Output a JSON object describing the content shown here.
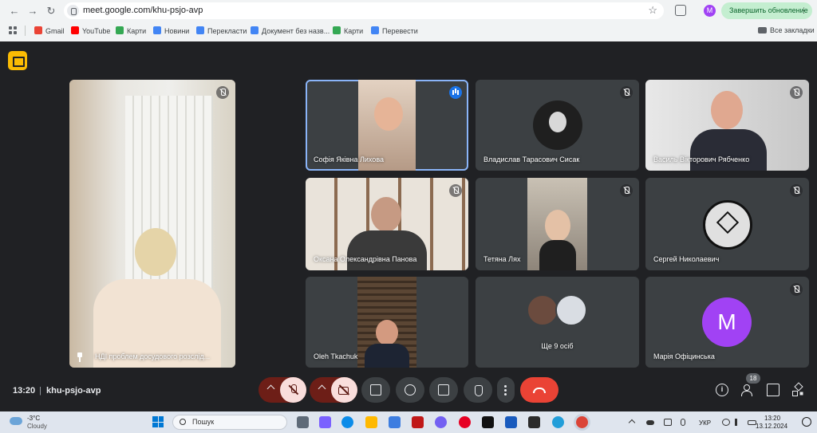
{
  "browser": {
    "url": "meet.google.com/khu-psjo-avp",
    "update_label": "Завершить обновление",
    "profile_initial": "M",
    "bookmarks": [
      {
        "label": "Gmail",
        "color": "#ea4335"
      },
      {
        "label": "YouTube",
        "color": "#ff0000"
      },
      {
        "label": "Карти",
        "color": "#34a853"
      },
      {
        "label": "Новини",
        "color": "#4285f4"
      },
      {
        "label": "Перекласти",
        "color": "#4285f4"
      },
      {
        "label": "Документ без назв...",
        "color": "#4285f4"
      },
      {
        "label": "Карти",
        "color": "#34a853"
      },
      {
        "label": "Перевести",
        "color": "#4285f4"
      }
    ],
    "all_bookmarks_label": "Все закладки"
  },
  "meet": {
    "pinned": {
      "name": "НДІ проблем досудового розслід..."
    },
    "tiles": [
      {
        "name": "Софія Яківна Лихова",
        "state": "speaking"
      },
      {
        "name": "Владислав Тарасович Сисак",
        "state": "muted"
      },
      {
        "name": "Василь Вікторович Рябченко",
        "state": "muted"
      },
      {
        "name": "Оксана Олександрівна Панова",
        "state": "muted"
      },
      {
        "name": "Тетяна Лях",
        "state": "muted"
      },
      {
        "name": "Сергей Николаевич",
        "state": "muted"
      },
      {
        "name": "Oleh Tkachuk",
        "state": "none"
      },
      {
        "name": "Ще 9 осіб",
        "state": "none"
      },
      {
        "name": "Марія Офіцинська",
        "state": "muted",
        "avatar_letter": "M",
        "avatar_color": "#a142f4"
      }
    ],
    "time": "13:20",
    "separator": "|",
    "code": "khu-psjo-avp",
    "participants_count": "18"
  },
  "taskbar": {
    "temperature": "-3°C",
    "weather": "Cloudy",
    "search_placeholder": "Пошук",
    "language": "УКР",
    "clock_time": "13:20",
    "clock_date": "13.12.2024",
    "apps": [
      {
        "name": "file-explorer-icon",
        "color": "#f4b400"
      },
      {
        "name": "copilot-icon",
        "color": "#7b61ff"
      },
      {
        "name": "edge-icon",
        "color": "#0c8ce9"
      },
      {
        "name": "folder-icon",
        "color": "#ffb900"
      },
      {
        "name": "store-icon",
        "color": "#3d7de0"
      },
      {
        "name": "mcafee-icon",
        "color": "#c01818"
      },
      {
        "name": "viber-icon",
        "color": "#7360f2"
      },
      {
        "name": "pinterest-icon",
        "color": "#e60023"
      },
      {
        "name": "tiktok-icon",
        "color": "#111111"
      },
      {
        "name": "word-icon",
        "color": "#185abd"
      },
      {
        "name": "terminal-icon",
        "color": "#2b2b2b"
      },
      {
        "name": "telegram-icon",
        "color": "#229ed9"
      },
      {
        "name": "chrome-icon",
        "color": "#db4437"
      }
    ]
  }
}
